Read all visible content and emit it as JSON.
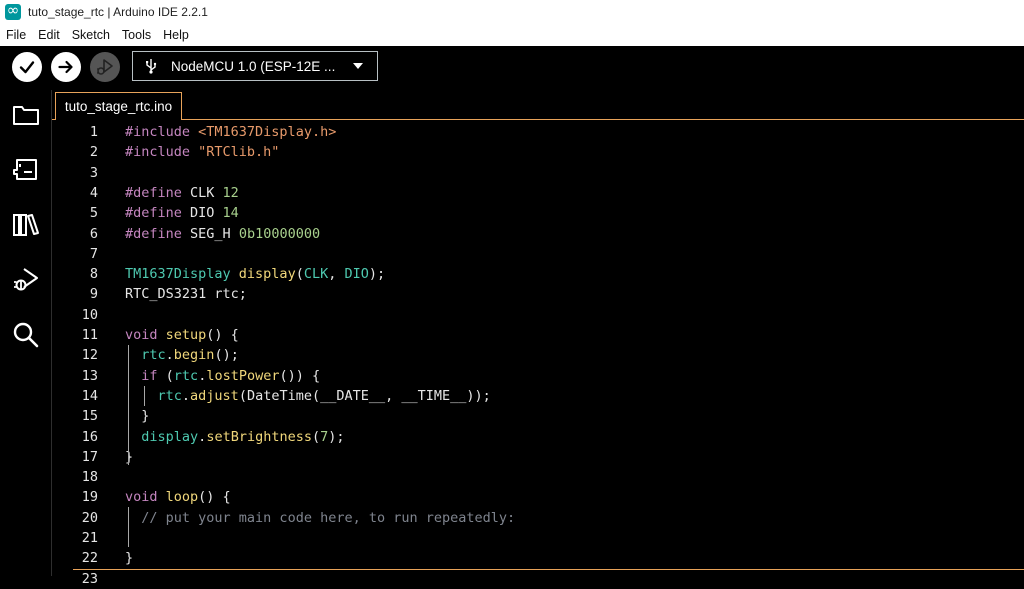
{
  "window": {
    "title": "tuto_stage_rtc | Arduino IDE 2.2.1"
  },
  "menu": [
    "File",
    "Edit",
    "Sketch",
    "Tools",
    "Help"
  ],
  "toolbar": {
    "board": "NodeMCU 1.0 (ESP-12E ..."
  },
  "tabs": [
    {
      "label": "tuto_stage_rtc.ino"
    }
  ],
  "editor": {
    "lines": [
      {
        "n": "1",
        "tokens": [
          [
            "pre",
            "#include "
          ],
          [
            "str",
            "<TM1637Display.h>"
          ]
        ]
      },
      {
        "n": "2",
        "tokens": [
          [
            "pre",
            "#include "
          ],
          [
            "str",
            "\"RTClib.h\""
          ]
        ]
      },
      {
        "n": "3",
        "tokens": []
      },
      {
        "n": "4",
        "tokens": [
          [
            "pre",
            "#define "
          ],
          [
            "txt",
            "CLK "
          ],
          [
            "num",
            "12"
          ]
        ]
      },
      {
        "n": "5",
        "tokens": [
          [
            "pre",
            "#define "
          ],
          [
            "txt",
            "DIO "
          ],
          [
            "num",
            "14"
          ]
        ]
      },
      {
        "n": "6",
        "tokens": [
          [
            "pre",
            "#define "
          ],
          [
            "txt",
            "SEG_H "
          ],
          [
            "num",
            "0b10000000"
          ]
        ]
      },
      {
        "n": "7",
        "tokens": []
      },
      {
        "n": "8",
        "tokens": [
          [
            "type",
            "TM1637Display "
          ],
          [
            "fn",
            "display"
          ],
          [
            "txt",
            "("
          ],
          [
            "type",
            "CLK"
          ],
          [
            "txt",
            ", "
          ],
          [
            "type",
            "DIO"
          ],
          [
            "txt",
            ");"
          ]
        ]
      },
      {
        "n": "9",
        "tokens": [
          [
            "txt",
            "RTC_DS3231 rtc;"
          ]
        ]
      },
      {
        "n": "10",
        "tokens": []
      },
      {
        "n": "11",
        "tokens": [
          [
            "kw",
            "void "
          ],
          [
            "fn",
            "setup"
          ],
          [
            "txt",
            "() {"
          ]
        ]
      },
      {
        "n": "12",
        "tokens": [
          [
            "txt",
            "  "
          ],
          [
            "type",
            "rtc"
          ],
          [
            "txt",
            "."
          ],
          [
            "fn",
            "begin"
          ],
          [
            "txt",
            "();"
          ]
        ]
      },
      {
        "n": "13",
        "tokens": [
          [
            "txt",
            "  "
          ],
          [
            "kw",
            "if "
          ],
          [
            "txt",
            "("
          ],
          [
            "type",
            "rtc"
          ],
          [
            "txt",
            "."
          ],
          [
            "fn",
            "lostPower"
          ],
          [
            "txt",
            "()) {"
          ]
        ]
      },
      {
        "n": "14",
        "tokens": [
          [
            "txt",
            "    "
          ],
          [
            "type",
            "rtc"
          ],
          [
            "txt",
            "."
          ],
          [
            "fn",
            "adjust"
          ],
          [
            "txt",
            "(DateTime(__DATE__, __TIME__));"
          ]
        ]
      },
      {
        "n": "15",
        "tokens": [
          [
            "txt",
            "  }"
          ]
        ]
      },
      {
        "n": "16",
        "tokens": [
          [
            "txt",
            "  "
          ],
          [
            "type",
            "display"
          ],
          [
            "txt",
            "."
          ],
          [
            "fn",
            "setBrightness"
          ],
          [
            "txt",
            "("
          ],
          [
            "num",
            "7"
          ],
          [
            "txt",
            ");"
          ]
        ]
      },
      {
        "n": "17",
        "tokens": [
          [
            "txt",
            "}"
          ]
        ]
      },
      {
        "n": "18",
        "tokens": []
      },
      {
        "n": "19",
        "tokens": [
          [
            "kw",
            "void "
          ],
          [
            "fn",
            "loop"
          ],
          [
            "txt",
            "() {"
          ]
        ]
      },
      {
        "n": "20",
        "tokens": [
          [
            "txt",
            "  "
          ],
          [
            "cmt",
            "// put your main code here, to run repeatedly:"
          ]
        ]
      },
      {
        "n": "21",
        "tokens": []
      },
      {
        "n": "22",
        "tokens": [
          [
            "txt",
            "}"
          ]
        ]
      },
      {
        "n": "23",
        "tokens": []
      }
    ]
  },
  "colors": {
    "accent": "#e8a35a",
    "teal": "#00979d"
  },
  "icons": [
    "verify-icon",
    "upload-icon",
    "debug-icon",
    "usb-icon",
    "folder-icon",
    "boards-manager-icon",
    "library-icon",
    "debug-sidebar-icon",
    "search-icon"
  ]
}
